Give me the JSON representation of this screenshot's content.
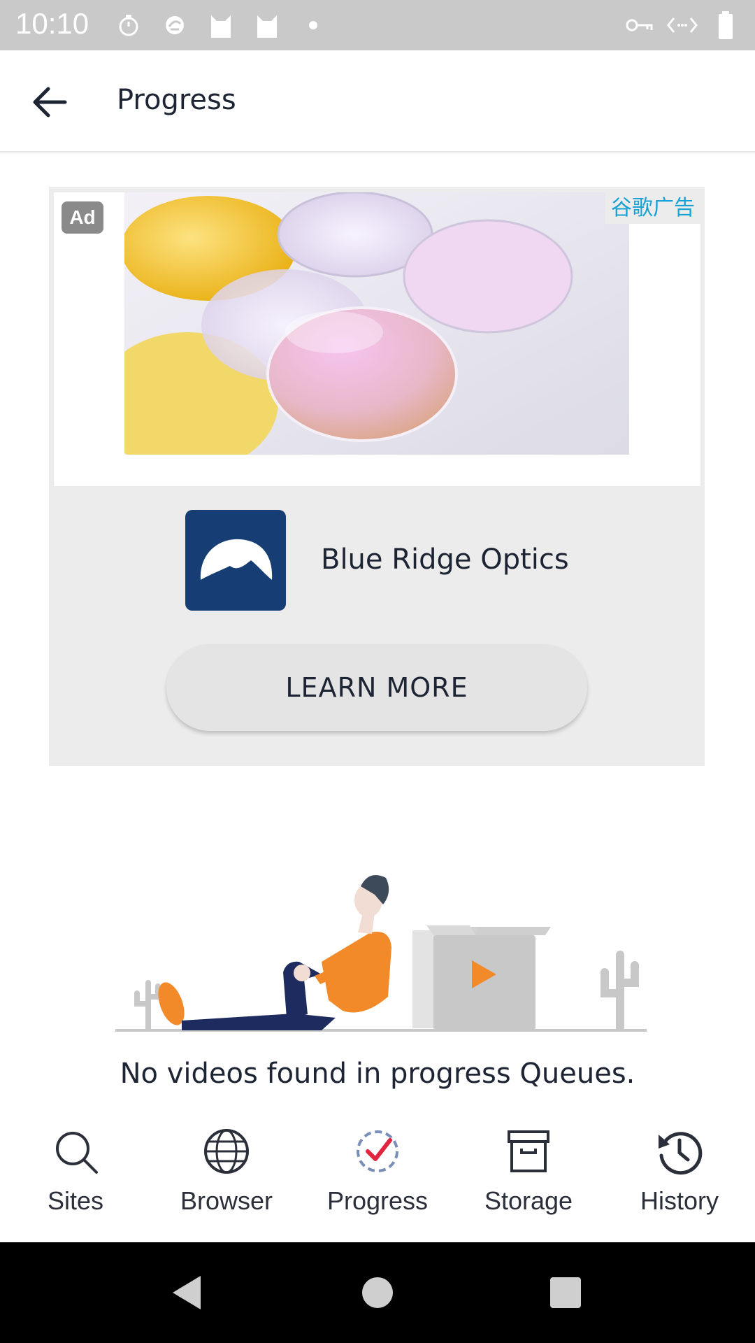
{
  "status_bar": {
    "time": "10:10",
    "left_icons": [
      "timer-icon",
      "sync-icon",
      "cat-icon",
      "cat-icon",
      "dot-icon"
    ],
    "right_icons": [
      "vpn-key-icon",
      "code-icon",
      "battery-icon"
    ]
  },
  "app_bar": {
    "title": "Progress",
    "back_icon": "arrow-back-icon"
  },
  "ad": {
    "badge": "Ad",
    "network_label": "谷歌广告",
    "advertiser": "Blue Ridge Optics",
    "cta": "LEARN MORE",
    "colors": {
      "logo_bg": "#163e74",
      "network_label": "#18a2d4"
    }
  },
  "empty_state": {
    "message": "No videos found in progress Queues."
  },
  "bottom_nav": {
    "active": "Progress",
    "items": [
      {
        "label": "Sites",
        "icon": "search-icon"
      },
      {
        "label": "Browser",
        "icon": "globe-icon"
      },
      {
        "label": "Progress",
        "icon": "progress-check-icon"
      },
      {
        "label": "Storage",
        "icon": "archive-icon"
      },
      {
        "label": "History",
        "icon": "history-icon"
      }
    ]
  },
  "system_nav": {
    "buttons": [
      "back-triangle-icon",
      "home-circle-icon",
      "recents-square-icon"
    ]
  }
}
